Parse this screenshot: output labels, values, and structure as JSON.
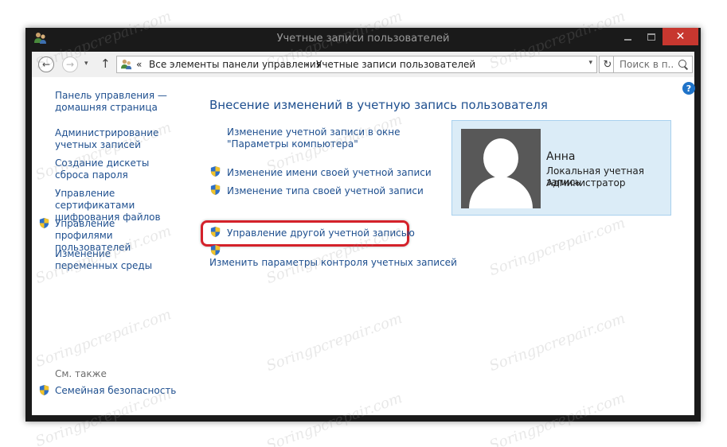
{
  "window": {
    "title": "Учетные записи пользователей",
    "controls": {
      "minimize": "",
      "maximize": "",
      "close": "✕"
    }
  },
  "navbar": {
    "back": "←",
    "forward": "→",
    "history": "▾",
    "up": "↑",
    "breadcrumb_prefix": "«",
    "crumb1": "Все элементы панели управления",
    "separator": "›",
    "crumb2": "Учетные записи пользователей",
    "dropdown": "▾",
    "refresh": "↻",
    "search_placeholder": "Поиск в п..."
  },
  "help": "?",
  "sidebar": {
    "home_link": "Панель управления — домашняя страница",
    "items": [
      {
        "label": "Администрирование учетных записей",
        "shield": false
      },
      {
        "label": "Создание дискеты сброса пароля",
        "shield": false
      },
      {
        "label": "Управление сертификатами шифрования файлов",
        "shield": false
      },
      {
        "label": "Управление профилями пользователей",
        "shield": true
      },
      {
        "label": "Изменение переменных среды",
        "shield": false
      }
    ],
    "see_also": "См. также",
    "family_safety": "Семейная безопасность"
  },
  "main": {
    "heading": "Внесение изменений в учетную запись пользователя",
    "tasks": [
      {
        "label": "Изменение учетной записи в окне \"Параметры компьютера\"",
        "shield": false
      },
      {
        "label": "Изменение имени своей учетной записи",
        "shield": true
      },
      {
        "label": "Изменение типа своей учетной записи",
        "shield": true
      },
      {
        "label": "Управление другой учетной записью",
        "shield": true,
        "highlighted": true
      },
      {
        "label": "Изменить параметры контроля учетных записей",
        "shield": true
      }
    ]
  },
  "account": {
    "name": "Анна",
    "type": "Локальная учетная запись",
    "role": "Администратор"
  },
  "watermark": "Soringpcrepair.com",
  "colors": {
    "link": "#1e4f8f",
    "highlight_box": "#d4212a",
    "card_bg": "#dbecf7",
    "close_button": "#c7372f"
  }
}
